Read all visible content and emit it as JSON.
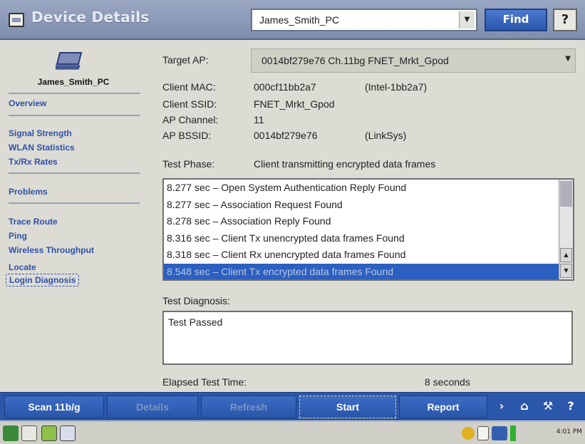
{
  "title_bar": {
    "app_title": "Device Details",
    "device_select_value": "James_Smith_PC",
    "find_label": "Find",
    "help_label": "?"
  },
  "sidebar": {
    "device_name": "James_Smith_PC",
    "links": {
      "overview": "Overview",
      "signal_strength": "Signal Strength",
      "wlan_statistics": "WLAN Statistics",
      "tx_rx_rates": "Tx/Rx Rates",
      "problems": "Problems",
      "trace_route": "Trace Route",
      "ping": "Ping",
      "wireless_throughput": "Wireless Throughput",
      "locate": "Locate",
      "login_diagnosis": "Login Diagnosis"
    }
  },
  "main": {
    "target_ap_label": "Target AP:",
    "target_ap_value": "0014bf279e76 Ch.11bg FNET_Mrkt_Gpod",
    "client_mac_label": "Client MAC:",
    "client_mac_value": "000cf11bb2a7",
    "client_mac_vendor": "(Intel-1bb2a7)",
    "client_ssid_label": "Client SSID:",
    "client_ssid_value": "FNET_Mrkt_Gpod",
    "ap_channel_label": "AP Channel:",
    "ap_channel_value": "11",
    "ap_bssid_label": "AP BSSID:",
    "ap_bssid_value": "0014bf279e76",
    "ap_bssid_vendor": "(LinkSys)",
    "test_phase_label": "Test Phase:",
    "test_phase_value": "Client transmitting encrypted data frames",
    "log": [
      "8.277 sec – Open System Authentication Reply Found",
      "8.277 sec – Association Request Found",
      "8.278 sec – Association Reply Found",
      "8.316 sec – Client Tx unencrypted data frames Found",
      "8.318 sec – Client Rx unencrypted data frames Found",
      "8.548 sec – Client Tx encrypted data frames Found"
    ],
    "test_diagnosis_label": "Test Diagnosis:",
    "test_diagnosis_value": "Test Passed",
    "elapsed_label": "Elapsed Test Time:",
    "elapsed_value": "8 seconds"
  },
  "toolbar": {
    "scan": "Scan 11b/g",
    "details": "Details",
    "refresh": "Refresh",
    "start": "Start",
    "report": "Report",
    "help": "?"
  },
  "taskbar": {
    "clock": "4:01 PM"
  },
  "colors": {
    "accent_blue": "#2c58ab",
    "link_blue": "#3050a8",
    "selection": "#2c60c0"
  }
}
